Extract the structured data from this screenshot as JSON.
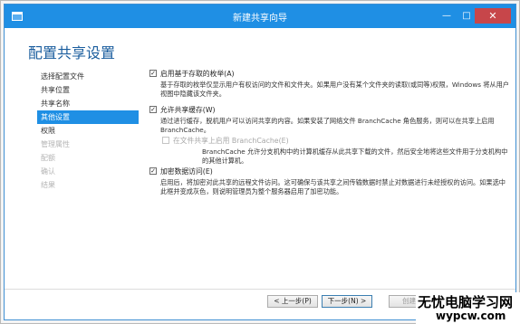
{
  "window": {
    "title": "新建共享向导",
    "minimize_glyph": "—",
    "maximize_glyph": "□",
    "close_glyph": "✕"
  },
  "page_heading": "配置共享设置",
  "nav": {
    "items": [
      {
        "label": "选择配置文件",
        "state": "normal"
      },
      {
        "label": "共享位置",
        "state": "normal"
      },
      {
        "label": "共享名称",
        "state": "normal"
      },
      {
        "label": "其他设置",
        "state": "active"
      },
      {
        "label": "权限",
        "state": "normal"
      },
      {
        "label": "管理属性",
        "state": "disabled"
      },
      {
        "label": "配额",
        "state": "disabled"
      },
      {
        "label": "确认",
        "state": "disabled"
      },
      {
        "label": "结果",
        "state": "disabled"
      }
    ]
  },
  "options": {
    "access_based_enum": {
      "label": "启用基于存取的枚举(A)",
      "checked": true,
      "description": "基于存取的枚举仅显示用户有权访问的文件和文件夹。如果用户没有某个文件夹的读取(或同等)权限，Windows 将从用户视图中隐藏该文件夹。"
    },
    "allow_caching": {
      "label": "允许共享缓存(W)",
      "checked": true,
      "description": "通过进行缓存，脱机用户可以访问共享的内容。如果安装了网络文件 BranchCache 角色服务，则可以在共享上启用 BranchCache。"
    },
    "branchcache": {
      "label": "在文件共享上启用 BranchCache(E)",
      "checked": false,
      "enabled": false,
      "description": "BranchCache 允许分支机构中的计算机缓存从此共享下载的文件，然后安全地将这些文件用于分支机构中的其他计算机。"
    },
    "encrypt": {
      "label": "加密数据访问(E)",
      "checked": true,
      "description": "启用后，将加密对此共享的远程文件访问。这可确保与该共享之间传输数据时禁止对数据进行未经授权的访问。如果选中此框并变成灰色，则说明管理员为整个服务器启用了加密功能。"
    }
  },
  "buttons": {
    "previous": "< 上一步(P)",
    "next": "下一步(N) >",
    "create": "创建(C)"
  },
  "watermark": {
    "line1": "无忧电脑学习网",
    "line2": "wypcw.com"
  },
  "colors": {
    "titlebar": "#1f8fe4",
    "heading": "#1a5d9e",
    "nav_active": "#1f8fe4",
    "close_button": "#c7464a"
  }
}
